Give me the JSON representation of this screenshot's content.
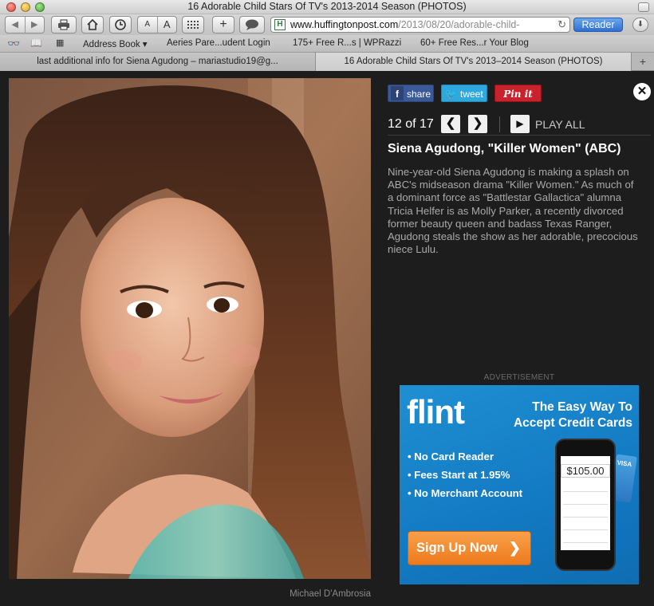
{
  "window": {
    "title": "16 Adorable Child Stars Of TV's 2013-2014 Season (PHOTOS)"
  },
  "toolbar": {
    "url_host": "www.huffingtonpost.com",
    "url_path": "/2013/08/20/adorable-child-",
    "reader_label": "Reader",
    "font_small": "A",
    "font_large": "A"
  },
  "bookmarks": [
    "Address Book ▾",
    "Aeries Pare...udent Login",
    "175+ Free R...s | WPRazzi",
    "60+ Free Res...r Your Blog"
  ],
  "tabs": [
    "last additional info for Siena Agudong – mariastudio19@g...",
    "16 Adorable Child Stars Of TV's 2013–2014 Season (PHOTOS)"
  ],
  "share": {
    "facebook": "share",
    "twitter": "tweet",
    "pinterest": "Pin it"
  },
  "slideshow": {
    "counter": "12 of 17",
    "play_all": "PLAY ALL",
    "title": "Siena Agudong, \"Killer Women\" (ABC)",
    "description": "Nine-year-old Siena Agudong is making a splash on ABC's midseason drama \"Killer Women.\" As much of a dominant force as \"Battlestar Gallactica\" alumna Tricia Helfer is as Molly Parker, a recently divorced former beauty queen and badass Texas Ranger, Agudong steals the show as her adorable, precocious niece Lulu.",
    "photo_credit": "Michael D'Ambrosia"
  },
  "ad": {
    "label": "ADVERTISEMENT",
    "brand": "flint",
    "tagline_1": "The Easy Way To",
    "tagline_2": "Accept Credit Cards",
    "features": [
      "• No Card Reader",
      "• Fees Start at 1.95%",
      "• No Merchant Account"
    ],
    "cta": "Sign Up Now",
    "amount": "$105.00",
    "card_brand": "VISA",
    "colors": {
      "background": "#1279c2",
      "cta": "#ee7a1c"
    }
  }
}
